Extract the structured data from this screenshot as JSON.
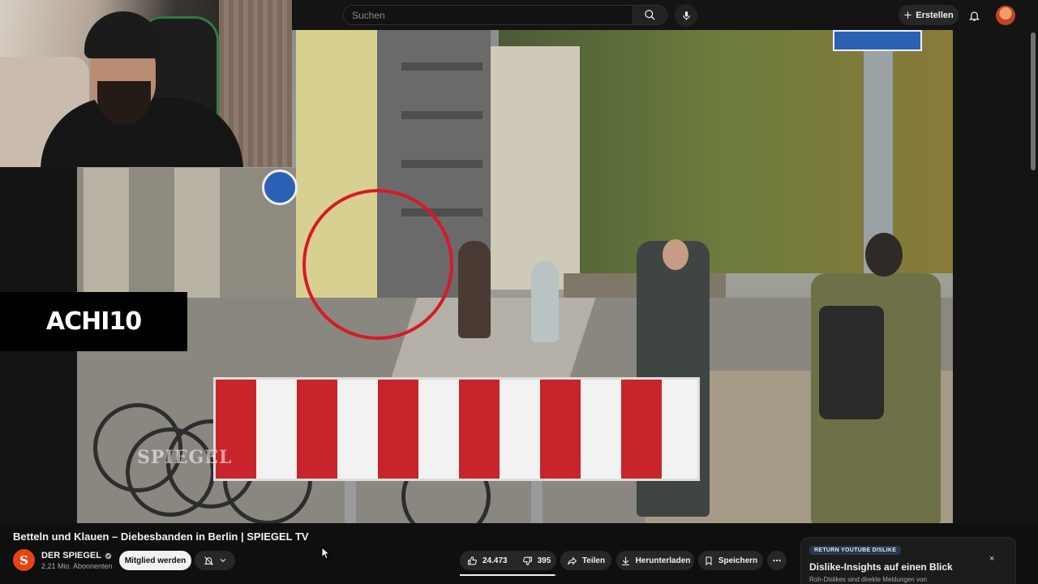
{
  "search": {
    "placeholder": "Suchen"
  },
  "header": {
    "create_label": "Erstellen"
  },
  "overlay": {
    "brand_text": "ACHI10"
  },
  "video": {
    "watermark_text": "SPIEGEL",
    "watermark_logo": "S",
    "title": "Betteln und Klauen – Diebesbanden in Berlin | SPIEGEL TV"
  },
  "channel": {
    "logo_letter": "S",
    "name": "DER SPIEGEL",
    "subscribers": "2,21 Mio. Abonnenten",
    "member_button": "Mitglied werden"
  },
  "actions": {
    "likes": "24.473",
    "dislikes": "395",
    "share": "Teilen",
    "download": "Herunterladen",
    "save": "Speichern",
    "like_ratio": 0.984
  },
  "ryd": {
    "badge": "RETURN YOUTUBE DISLIKE",
    "title": "Dislike-Insights auf einen Blick",
    "subtitle": "Roh-Dislikes sind direkte Meldungen von",
    "close": "×"
  },
  "colors": {
    "accent_red": "#d7192a",
    "spiegel_orange": "#e64415",
    "background": "#0f0f0f"
  }
}
